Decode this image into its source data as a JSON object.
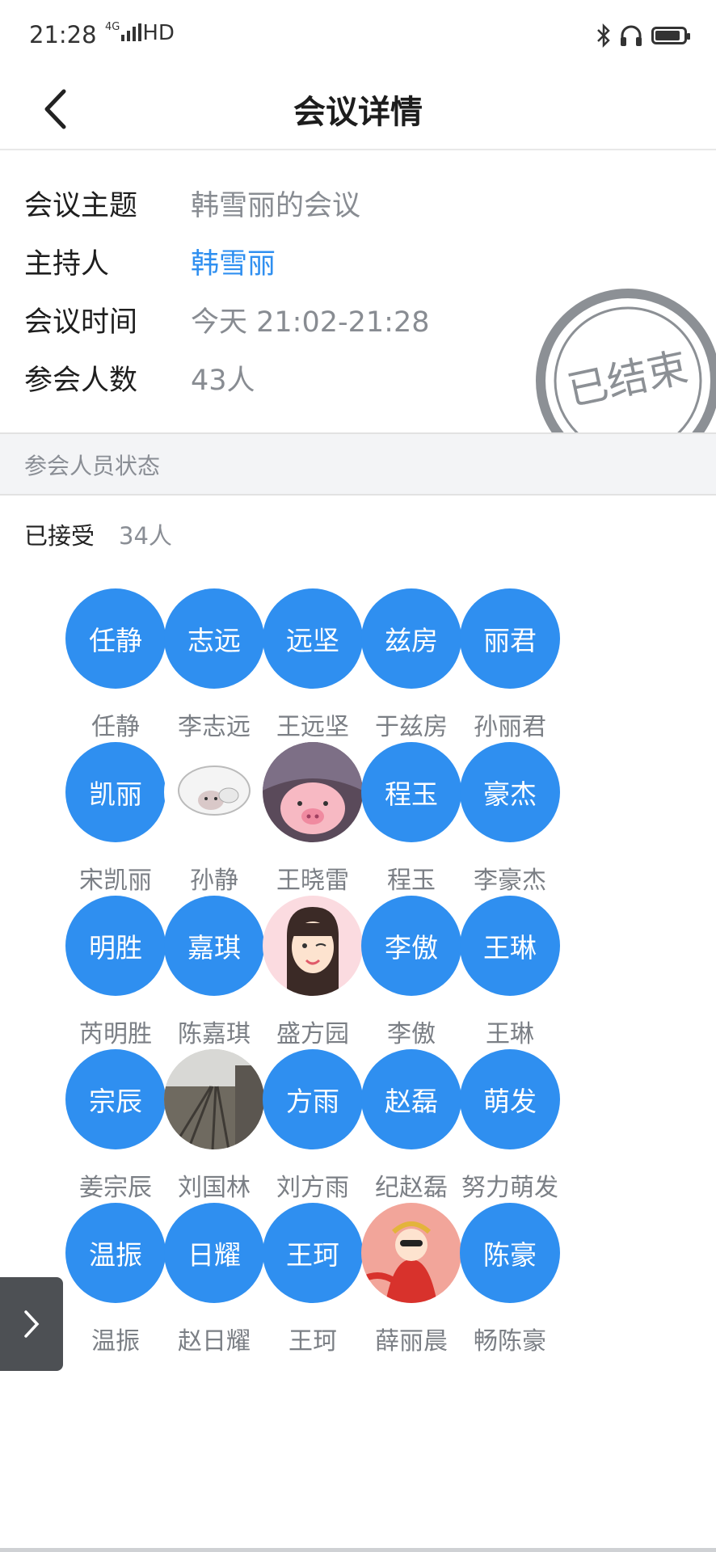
{
  "status_bar": {
    "time": "21:28",
    "network": "4G",
    "signal_text": "HD"
  },
  "header": {
    "title": "会议详情"
  },
  "meeting": {
    "topic_label": "会议主题",
    "topic": "韩雪丽的会议",
    "host_label": "主持人",
    "host": "韩雪丽",
    "time_label": "会议时间",
    "time": "今天 21:02-21:28",
    "count_label": "参会人数",
    "count": "43人",
    "stamp": "已结束"
  },
  "section": {
    "title": "参会人员状态"
  },
  "accepted": {
    "label": "已接受",
    "count": "34人"
  },
  "colors": {
    "accent": "#2f8ff0",
    "muted": "#888c92"
  },
  "participants": [
    {
      "avatar_text": "任静",
      "name": "任静"
    },
    {
      "avatar_text": "志远",
      "name": "李志远"
    },
    {
      "avatar_text": "远坚",
      "name": "王远坚"
    },
    {
      "avatar_text": "兹房",
      "name": "于兹房"
    },
    {
      "avatar_text": "丽君",
      "name": "孙丽君"
    },
    {
      "avatar_text": "凯丽",
      "name": "宋凯丽"
    },
    {
      "avatar_image": "cartoon-sheep",
      "name": "孙静"
    },
    {
      "avatar_image": "cartoon-pig",
      "name": "王晓雷"
    },
    {
      "avatar_text": "程玉",
      "name": "程玉"
    },
    {
      "avatar_text": "豪杰",
      "name": "李豪杰"
    },
    {
      "avatar_text": "明胜",
      "name": "芮明胜"
    },
    {
      "avatar_text": "嘉琪",
      "name": "陈嘉琪"
    },
    {
      "avatar_image": "cartoon-girl",
      "name": "盛方园"
    },
    {
      "avatar_text": "李傲",
      "name": "李傲"
    },
    {
      "avatar_text": "王琳",
      "name": "王琳"
    },
    {
      "avatar_text": "宗辰",
      "name": "姜宗辰"
    },
    {
      "avatar_image": "railway-photo",
      "name": "刘国林"
    },
    {
      "avatar_text": "方雨",
      "name": "刘方雨"
    },
    {
      "avatar_text": "赵磊",
      "name": "纪赵磊"
    },
    {
      "avatar_text": "萌发",
      "name": "努力萌发"
    },
    {
      "avatar_text": "温振",
      "name": "温振"
    },
    {
      "avatar_text": "日耀",
      "name": "赵日耀"
    },
    {
      "avatar_text": "王珂",
      "name": "王珂"
    },
    {
      "avatar_image": "cartoon-bride",
      "name": "薛丽晨"
    },
    {
      "avatar_text": "陈豪",
      "name": "畅陈豪"
    }
  ]
}
